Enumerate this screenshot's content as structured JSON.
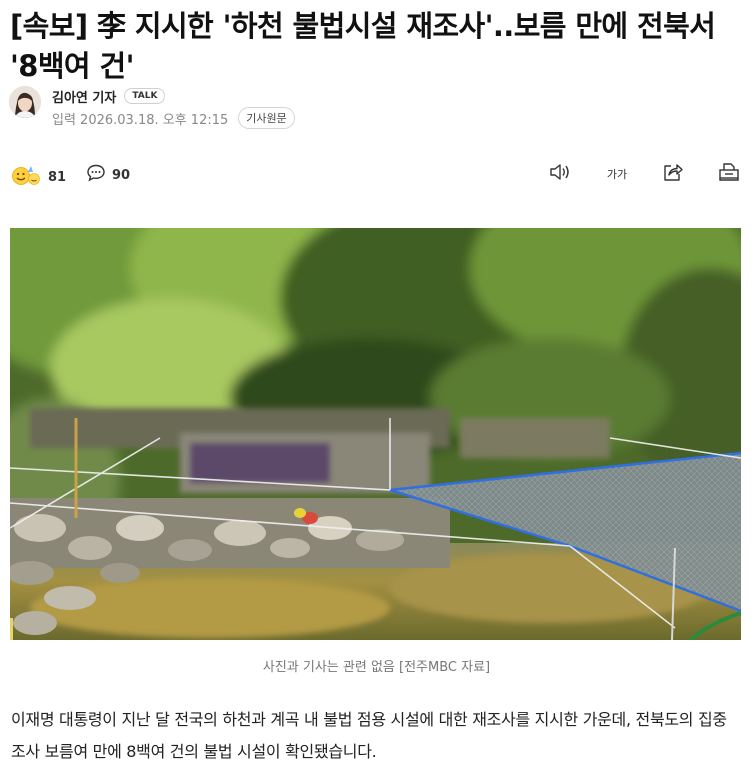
{
  "article": {
    "headline": "[속보] 李 지시한 '하천 불법시설 재조사'..보름 만에 전북서 '8백여 건'",
    "author": "김아연 기자",
    "talk_badge": "TALK",
    "date": "입력 2026.03.18. 오후 12:15",
    "original_button": "기사원문",
    "reactions_count": "81",
    "comments_count": "90",
    "font_size_label": "가가",
    "photo_caption": "사진과 기사는 관련 없음 [전주MBC 자료]",
    "body": "이재명 대통령이 지난 달 전국의 하천과 계곡 내 불법 점용 시설에 대한 재조사를 지시한 가운데, 전북도의 집중 조사 보름여 만에 8백여 건의 불법 시설이 확인됐습니다."
  },
  "icons": {
    "reaction": "emoji-reaction-icon",
    "comment": "speech-bubble-icon",
    "tts": "speaker-icon",
    "font_size": "font-size-icon",
    "share": "share-icon",
    "print": "print-icon"
  },
  "colors": {
    "headline": "#111111",
    "meta": "#888888",
    "caption": "#777777"
  }
}
